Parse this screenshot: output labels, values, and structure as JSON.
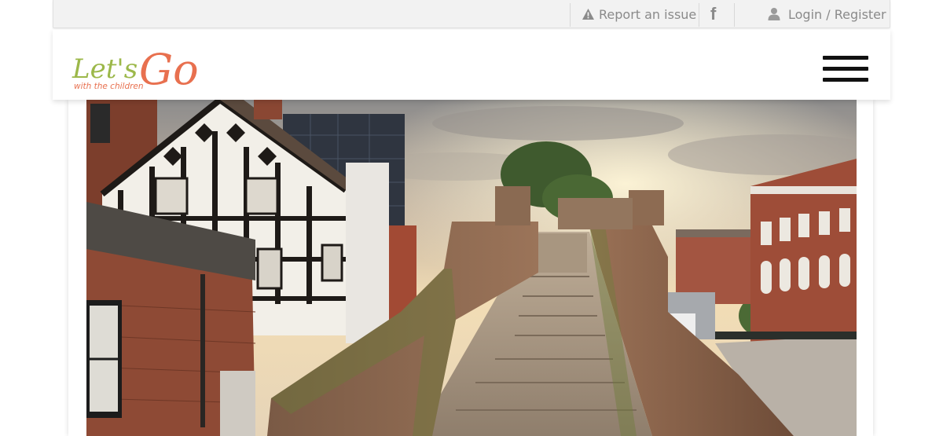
{
  "topbar": {
    "report_label": "Report an issue",
    "login_label": "Login / Register",
    "facebook_glyph": "f"
  },
  "brand": {
    "logo_main_1": "Let's",
    "logo_main_2": "Go",
    "logo_tagline": "with the children",
    "colors": {
      "green": "#9cb84a",
      "orange": "#e8704f",
      "icon_grey": "#9a9a9a"
    }
  },
  "icons": {
    "report": "warning-triangle-icon",
    "facebook": "facebook-icon",
    "user": "user-icon",
    "menu": "hamburger-menu-icon"
  }
}
